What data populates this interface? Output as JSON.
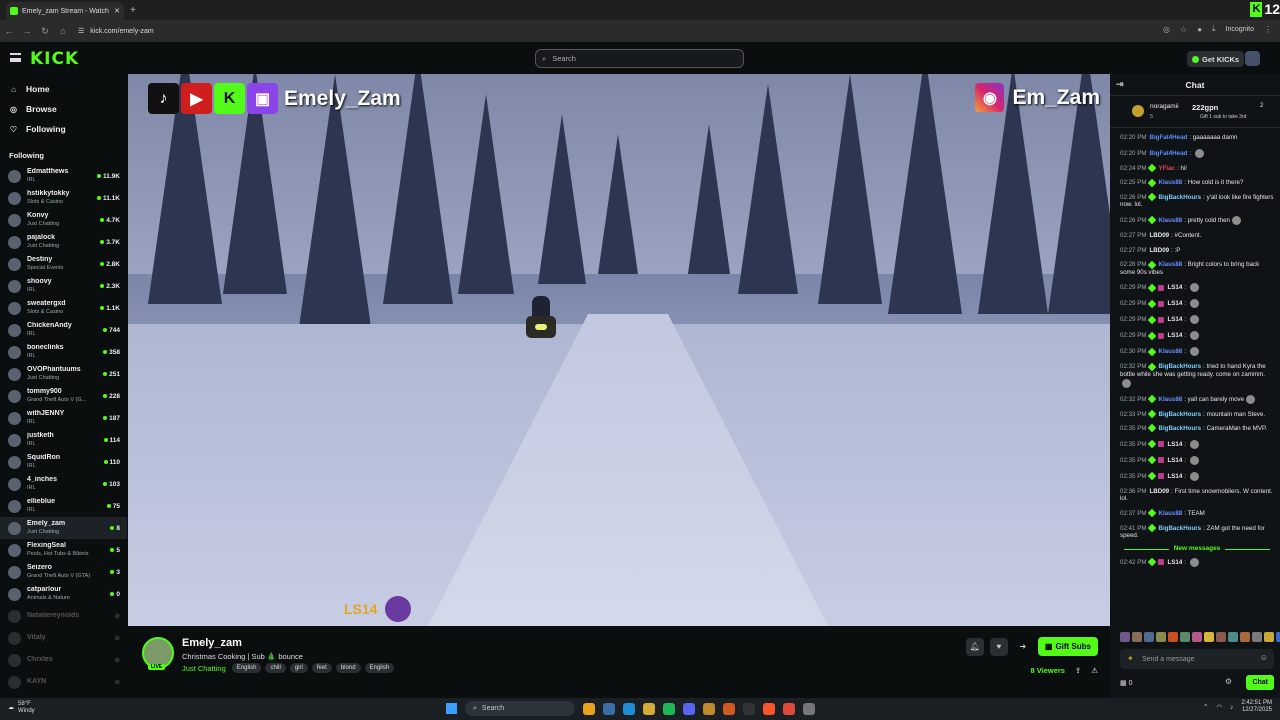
{
  "browser": {
    "tab_title": "Emely_zam Stream - Watch",
    "url": "kick.com/emely-zam",
    "incognito_label": "Incognito",
    "corner_count": "12"
  },
  "header": {
    "logo": "KICK",
    "search_placeholder": "Search",
    "get_kicks": "Get KICKs"
  },
  "sidebar": {
    "nav": [
      {
        "label": "Home"
      },
      {
        "label": "Browse"
      },
      {
        "label": "Following"
      }
    ],
    "following_title": "Following",
    "channels": [
      {
        "name": "Edmatthews",
        "category": "IRL",
        "viewers": "11.9K"
      },
      {
        "name": "hstikkytokky",
        "category": "Slots & Casino",
        "viewers": "11.1K"
      },
      {
        "name": "Konvy",
        "category": "Just Chatting",
        "viewers": "4.7K"
      },
      {
        "name": "pajalock",
        "category": "Just Chatting",
        "viewers": "3.7K"
      },
      {
        "name": "Destiny",
        "category": "Special Events",
        "viewers": "2.8K"
      },
      {
        "name": "shoovy",
        "category": "IRL",
        "viewers": "2.3K"
      },
      {
        "name": "sweatergxd",
        "category": "Slots & Casino",
        "viewers": "1.1K"
      },
      {
        "name": "ChickenAndy",
        "category": "IRL",
        "viewers": "744"
      },
      {
        "name": "boneclinks",
        "category": "IRL",
        "viewers": "358"
      },
      {
        "name": "OVOPhantuums",
        "category": "Just Chatting",
        "viewers": "251"
      },
      {
        "name": "tommy900",
        "category": "Grand Theft Auto V (G...",
        "viewers": "228"
      },
      {
        "name": "withJENNY",
        "category": "IRL",
        "viewers": "187"
      },
      {
        "name": "justketh",
        "category": "IRL",
        "viewers": "114"
      },
      {
        "name": "SquidRon",
        "category": "IRL",
        "viewers": "110"
      },
      {
        "name": "4_inches",
        "category": "IRL",
        "viewers": "103"
      },
      {
        "name": "ellieblue",
        "category": "IRL",
        "viewers": "75"
      },
      {
        "name": "Emely_zam",
        "category": "Just Chatting",
        "viewers": "8"
      },
      {
        "name": "FlexingSeal",
        "category": "Pools, Hot Tubs & Bikinis",
        "viewers": "5"
      },
      {
        "name": "Seizero",
        "category": "Grand Theft Auto V (GTA)",
        "viewers": "3"
      },
      {
        "name": "catparlour",
        "category": "Animals & Nature",
        "viewers": "0"
      }
    ],
    "offline": [
      "Nataliereynolds",
      "Vitaly",
      "Chrxles",
      "KAYN"
    ]
  },
  "video": {
    "overlay_name": "Emely_Zam",
    "overlay_ig": "Em_Zam",
    "alert_name": "LS14"
  },
  "stream": {
    "name": "Emely_zam",
    "title": "Christmas Cooking | Sub 🎄 bounce",
    "category": "Just Chatting",
    "tags": [
      "English",
      "chill",
      "girl",
      "feet",
      "blond",
      "English"
    ],
    "live_label": "LIVE",
    "gift_subs": "Gift Subs",
    "viewers": "8 Viewers"
  },
  "chat": {
    "title": "Chat",
    "pinned": {
      "user": "noragamii",
      "amount": "222gpn",
      "rank": "2",
      "sub_count": "5",
      "hint": "Gift 1 sub to take 3rd"
    },
    "messages": [
      {
        "time": "02:20 PM",
        "user": "BigFat4Head",
        "color": "#5b8cff",
        "badge": "none",
        "text": "gaaaaaaa damn"
      },
      {
        "time": "02:20 PM",
        "user": "BigFat4Head",
        "color": "#5b8cff",
        "badge": "none",
        "text": "",
        "emote": true
      },
      {
        "time": "02:24 PM",
        "user": "YFlac",
        "color": "#e14848",
        "badge": "sub",
        "text": "hi!"
      },
      {
        "time": "02:25 PM",
        "user": "Klaus88",
        "color": "#6a8cff",
        "badge": "sub",
        "text": "How cold is it there?"
      },
      {
        "time": "02:26 PM",
        "user": "BigBackHours",
        "color": "#7fd0ff",
        "badge": "sub",
        "text": "y'all look like fire fighters now. lol."
      },
      {
        "time": "02:26 PM",
        "user": "Klaus88",
        "color": "#6a8cff",
        "badge": "sub",
        "text": "pretty cold then",
        "emote": true
      },
      {
        "time": "02:27 PM",
        "user": "LBD09",
        "color": "#e6e6e6",
        "badge": "none",
        "text": "#Content."
      },
      {
        "time": "02:27 PM",
        "user": "LBD09",
        "color": "#e6e6e6",
        "badge": "none",
        "text": ":P"
      },
      {
        "time": "02:28 PM",
        "user": "Klaus88",
        "color": "#6a8cff",
        "badge": "sub",
        "text": "Bright colors to bring back some 90s vibes"
      },
      {
        "time": "02:29 PM",
        "user": "LS14",
        "color": "#e6e6e6",
        "badge": "gift",
        "text": "",
        "emote": true
      },
      {
        "time": "02:29 PM",
        "user": "LS14",
        "color": "#e6e6e6",
        "badge": "gift",
        "text": "",
        "emote": true
      },
      {
        "time": "02:29 PM",
        "user": "LS14",
        "color": "#e6e6e6",
        "badge": "gift",
        "text": "",
        "emote": true
      },
      {
        "time": "02:29 PM",
        "user": "LS14",
        "color": "#e6e6e6",
        "badge": "gift",
        "text": "",
        "emote": true
      },
      {
        "time": "02:30 PM",
        "user": "Klaus88",
        "color": "#6a8cff",
        "badge": "sub",
        "text": "",
        "emote": true
      },
      {
        "time": "02:32 PM",
        "user": "BigBackHours",
        "color": "#7fd0ff",
        "badge": "sub",
        "text": "tried to hand Kyra the bottle while she was getting ready. come on zammm.",
        "emote": true
      },
      {
        "time": "02:32 PM",
        "user": "Klaus88",
        "color": "#6a8cff",
        "badge": "sub",
        "text": "yall can barely move",
        "emote": true
      },
      {
        "time": "02:33 PM",
        "user": "BigBackHours",
        "color": "#7fd0ff",
        "badge": "sub",
        "text": "mountain man Steve."
      },
      {
        "time": "02:35 PM",
        "user": "BigBackHours",
        "color": "#7fd0ff",
        "badge": "sub",
        "text": "CameraMan the MVP."
      },
      {
        "time": "02:35 PM",
        "user": "LS14",
        "color": "#e6e6e6",
        "badge": "gift",
        "text": "",
        "emote": true
      },
      {
        "time": "02:35 PM",
        "user": "LS14",
        "color": "#e6e6e6",
        "badge": "gift",
        "text": "",
        "emote": true
      },
      {
        "time": "02:35 PM",
        "user": "LS14",
        "color": "#e6e6e6",
        "badge": "gift",
        "text": "",
        "emote": true
      },
      {
        "time": "02:36 PM",
        "user": "LBD09",
        "color": "#e6e6e6",
        "badge": "none",
        "text": "First time snowmobilers. W content. lol."
      },
      {
        "time": "02:37 PM",
        "user": "Klaus88",
        "color": "#6a8cff",
        "badge": "sub",
        "text": "TEAM"
      },
      {
        "time": "02:41 PM",
        "user": "BigBackHours",
        "color": "#7fd0ff",
        "badge": "sub",
        "text": "ZAM got the need for speed."
      }
    ],
    "new_messages": "New messages",
    "last": {
      "time": "02:42 PM",
      "user": "LS14",
      "text": ""
    },
    "input_placeholder": "Send a message",
    "points": "0",
    "chat_button": "Chat"
  },
  "taskbar": {
    "weather_temp": "58°F",
    "weather_desc": "Windy",
    "search": "Search",
    "time": "2:42:51 PM",
    "date": "12/27/2025"
  }
}
